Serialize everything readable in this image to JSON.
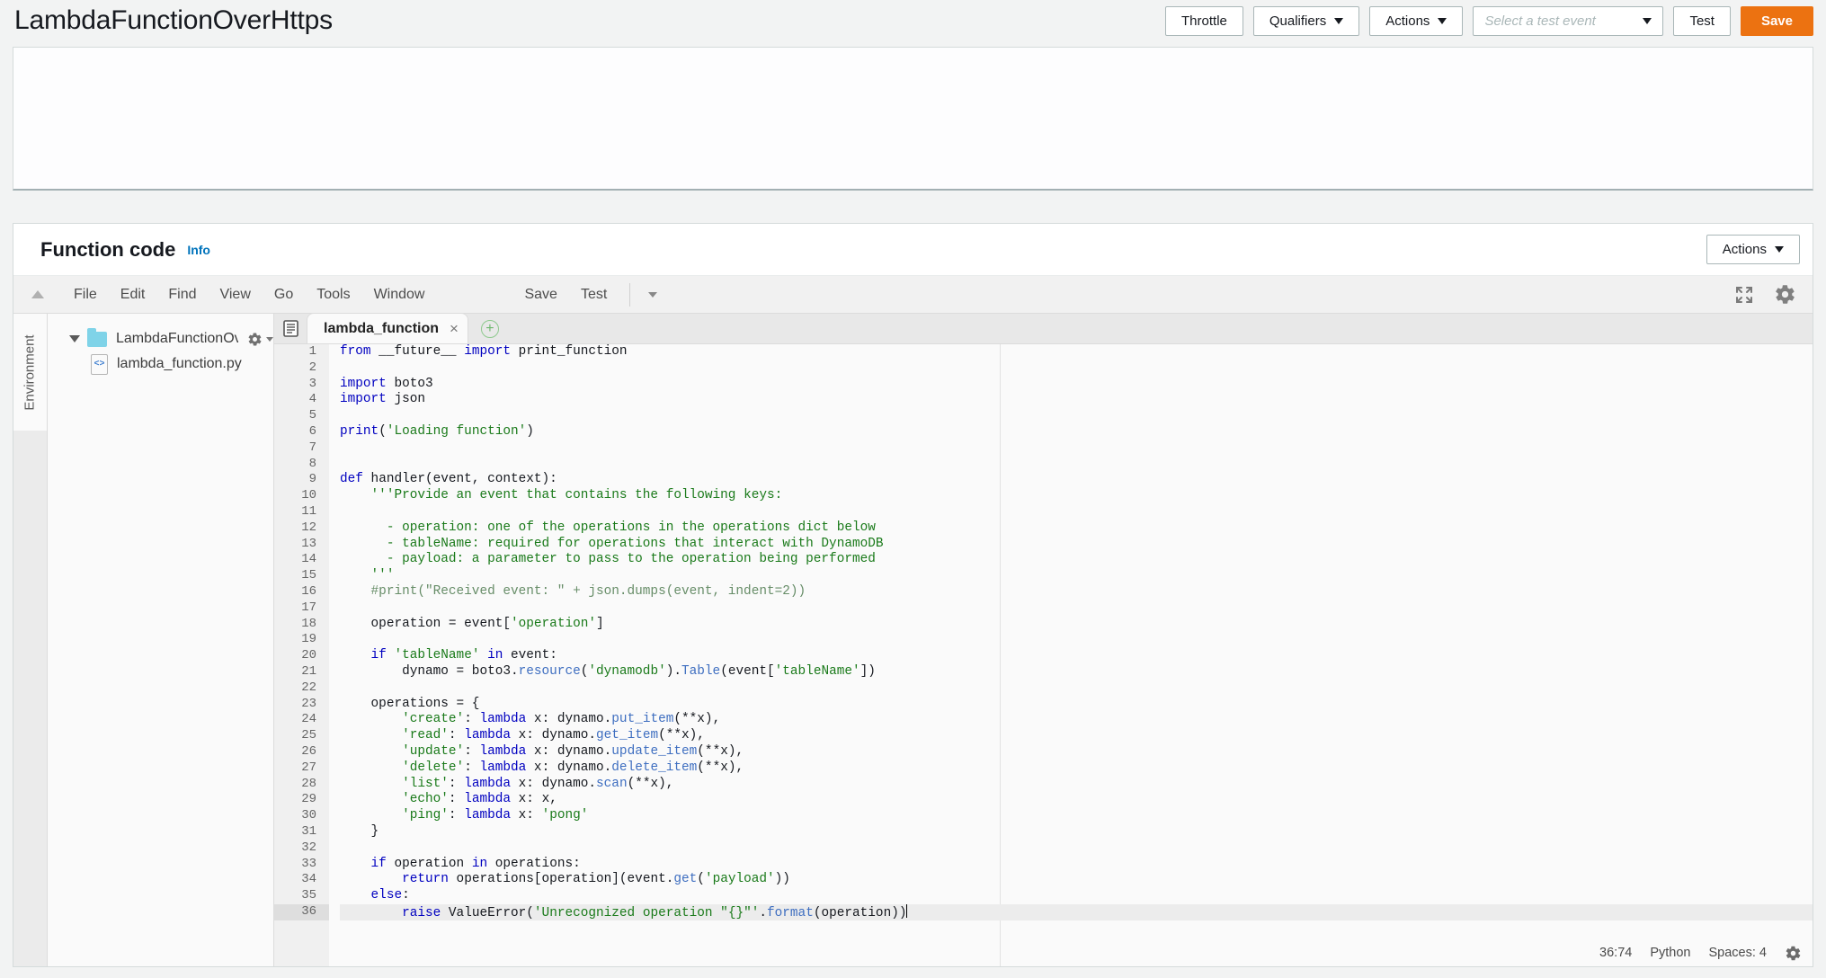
{
  "header": {
    "function_name": "LambdaFunctionOverHttps",
    "buttons": {
      "throttle": "Throttle",
      "qualifiers": "Qualifiers",
      "actions": "Actions",
      "test": "Test",
      "save": "Save"
    },
    "test_event_select": {
      "placeholder": "Select a test event",
      "value": ""
    },
    "accent_color": "#ec7211"
  },
  "function_code": {
    "title": "Function code",
    "info_link": "Info",
    "actions_button": "Actions"
  },
  "ide": {
    "menu": [
      "File",
      "Edit",
      "Find",
      "View",
      "Go",
      "Tools",
      "Window"
    ],
    "save_label": "Save",
    "test_label": "Test",
    "env_rail_label": "Environment",
    "tree": {
      "folder": "LambdaFunctionOv",
      "file": "lambda_function.py",
      "file_icon_glyph": "<>"
    },
    "tab": {
      "title": "lambda_function",
      "close_glyph": "×",
      "new_tab_glyph": "+"
    },
    "statusbar": {
      "cursor_position": "36:74",
      "language": "Python",
      "indent": "Spaces: 4"
    }
  },
  "code": {
    "language": "python",
    "active_line": 36,
    "total_lines": 36,
    "lines": [
      "from __future__ import print_function",
      "",
      "import boto3",
      "import json",
      "",
      "print('Loading function')",
      "",
      "",
      "def handler(event, context):",
      "    '''Provide an event that contains the following keys:",
      "",
      "      - operation: one of the operations in the operations dict below",
      "      - tableName: required for operations that interact with DynamoDB",
      "      - payload: a parameter to pass to the operation being performed",
      "    '''",
      "    #print(\"Received event: \" + json.dumps(event, indent=2))",
      "",
      "    operation = event['operation']",
      "",
      "    if 'tableName' in event:",
      "        dynamo = boto3.resource('dynamodb').Table(event['tableName'])",
      "",
      "    operations = {",
      "        'create': lambda x: dynamo.put_item(**x),",
      "        'read': lambda x: dynamo.get_item(**x),",
      "        'update': lambda x: dynamo.update_item(**x),",
      "        'delete': lambda x: dynamo.delete_item(**x),",
      "        'list': lambda x: dynamo.scan(**x),",
      "        'echo': lambda x: x,",
      "        'ping': lambda x: 'pong'",
      "    }",
      "",
      "    if operation in operations:",
      "        return operations[operation](event.get('payload'))",
      "    else:",
      "        raise ValueError('Unrecognized operation \"{}\"'.format(operation))"
    ]
  }
}
